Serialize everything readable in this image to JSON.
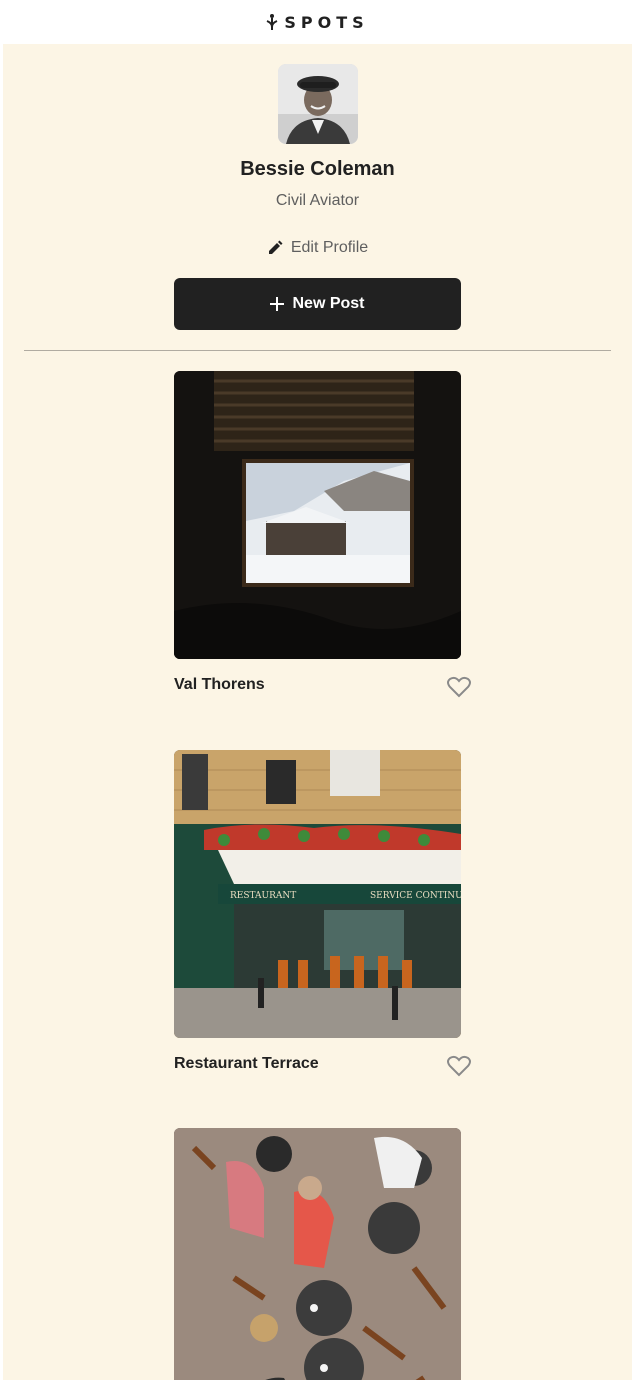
{
  "header": {
    "logo_text": "SPOTS",
    "logo_icon": "flower-icon"
  },
  "profile": {
    "name": "Bessie Coleman",
    "role": "Civil Aviator",
    "edit_label": "Edit Profile",
    "edit_icon": "pencil-icon",
    "new_post_label": "New Post",
    "new_post_icon": "plus-icon"
  },
  "posts": [
    {
      "title": "Val Thorens",
      "liked": false,
      "image": "mountain-village-through-window"
    },
    {
      "title": "Restaurant Terrace",
      "liked": false,
      "image": "restaurant-storefront"
    },
    {
      "title": "",
      "liked": false,
      "image": "outdoor-cafe-tables"
    }
  ],
  "colors": {
    "page_bg": "#fcf5e5",
    "header_bg": "#ffffff",
    "button_bg": "#212121",
    "text": "#212121",
    "muted_text": "#5f5f5f"
  }
}
